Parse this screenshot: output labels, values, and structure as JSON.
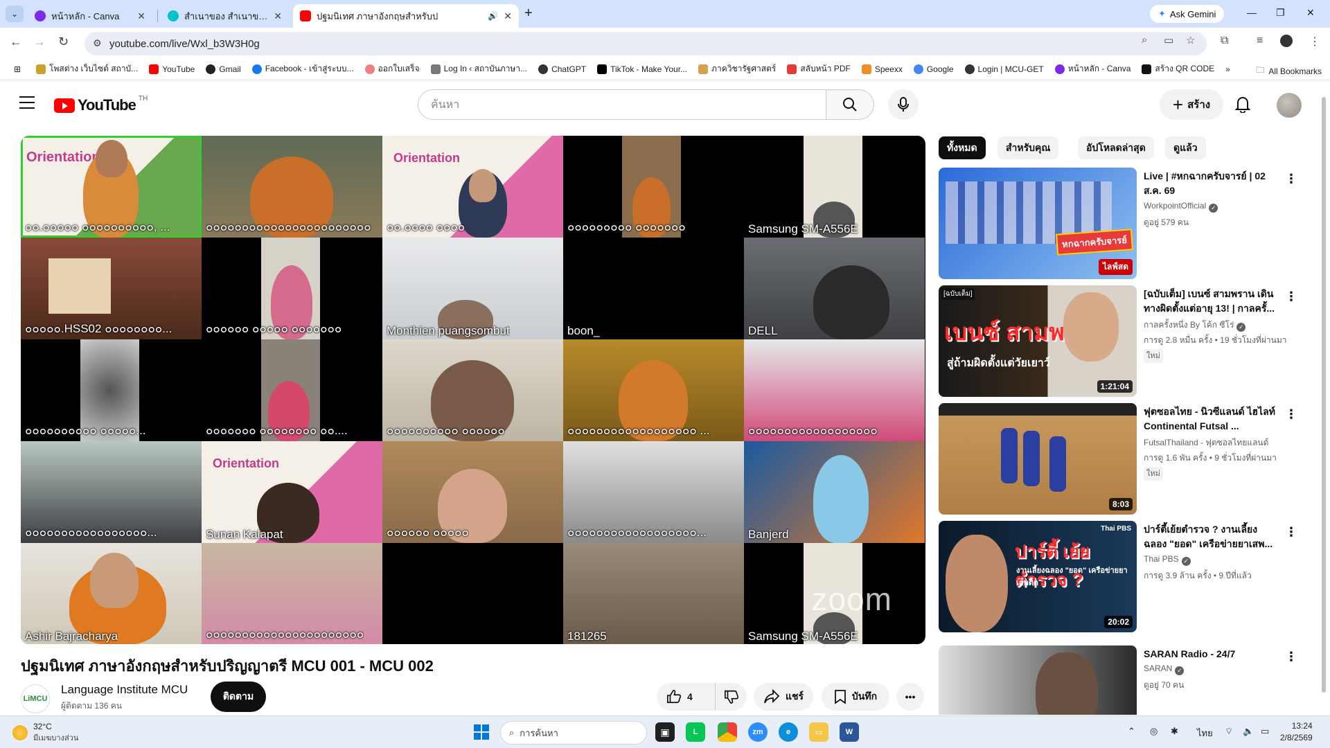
{
  "browser": {
    "tabs": [
      {
        "title": "หน้าหลัก - Canva",
        "active": false
      },
      {
        "title": "สำเนาของ สำเนาของ จดหมายข่าว -",
        "active": false
      },
      {
        "title": "ปฐมนิเทศ ภาษาอังกฤษสำหรับป",
        "active": true
      }
    ],
    "ask_gemini": "Ask Gemini",
    "url": "youtube.com/live/Wxl_b3W3H0g",
    "bookmarks": [
      "โพสต่าง เว็บไซต์ สถาบั...",
      "YouTube",
      "Gmail",
      "Facebook - เข้าสู่ระบบ...",
      "ออกใบเสร็จ",
      "Log In ‹ สถาบันภาษา...",
      "ChatGPT",
      "TikTok - Make Your...",
      "ภาควิชารัฐศาสตร์",
      "สลับหน้า PDF",
      "Speexx",
      "Google",
      "Login | MCU-GET",
      "หน้าหลัก - Canva",
      "สร้าง QR CODE"
    ],
    "all_bookmarks": "All Bookmarks"
  },
  "youtube": {
    "logo_text": "YouTube",
    "country_code": "TH",
    "search_placeholder": "ค้นหา",
    "create_label": "สร้าง"
  },
  "video": {
    "title": "ปฐมนิเทศ ภาษาอังกฤษสำหรับปริญญาตรี MCU 001 - MCU 002",
    "participants": [
      "๐๐.๐๐๐๐๐ ๐๐๐๐๐๐๐๐๐๐, ...",
      "๐๐๐๐๐๐๐๐๐๐๐๐๐๐๐๐๐๐๐๐๐๐๐",
      "๐๐.๐๐๐๐ ๐๐๐๐",
      "๐๐๐๐๐๐๐๐๐ ๐๐๐๐๐๐๐",
      "Samsung SM-A556E",
      "๐๐๐๐๐.HSS02 ๐๐๐๐๐๐๐๐...",
      "๐๐๐๐๐๐ ๐๐๐๐๐ ๐๐๐๐๐๐๐",
      "Monthien puangsombut",
      "boon_",
      "DELL",
      "๐๐๐๐๐๐๐๐๐๐ ๐๐๐๐๐...",
      "๐๐๐๐๐๐๐ ๐๐๐๐๐๐๐๐  ๐๐....",
      "๐๐๐๐๐๐๐๐๐๐ ๐๐๐๐๐๐",
      "๐๐๐๐๐๐๐๐๐๐๐๐๐๐๐๐๐๐ ...",
      "๐๐๐๐๐๐๐๐๐๐๐๐๐๐๐๐๐๐",
      "๐๐๐๐๐๐๐๐๐๐๐๐๐๐๐๐๐...",
      "Sunan Kalapat",
      "๐๐๐๐๐๐ ๐๐๐๐๐",
      "๐๐๐๐๐๐๐๐๐๐๐๐๐๐๐๐๐๐...",
      "Banjerd",
      "Ashir Bajracharya",
      "๐๐๐๐๐๐๐๐๐๐๐๐๐๐๐๐๐๐๐๐๐๐",
      "",
      "181265",
      "Samsung SM-A556E"
    ],
    "zoom_watermark": "zoom",
    "channel": {
      "name": "Language Institute MCU",
      "subscribers": "ผู้ติดตาม 136 คน",
      "avatar_text": "LiMCU",
      "subscribe_label": "ติดตาม"
    },
    "like_count": "4",
    "share_label": "แชร์",
    "save_label": "บันทึก"
  },
  "chips": [
    "ทั้งหมด",
    "สำหรับคุณ",
    "อัปโหลดล่าสุด",
    "ดูแล้ว"
  ],
  "recommendations": [
    {
      "title": "Live | #หกฉากครับจารย์ | 02 ส.ค. 69",
      "channel": "WorkpointOfficial",
      "meta": "ดูอยู่ 579 คน",
      "badge": "",
      "overlay": "ไลฟ์สด",
      "verified": true
    },
    {
      "title": "[ฉบับเต็ม] เบนซ์ สามพราน เดินทางผิดตั้งแต่อายุ 13! | กาลครั้...",
      "channel": "กาลครั้งหนึ่ง By โค้ก ซีโร่",
      "meta": "การดู 2.8 หมื่น ครั้ง • 19 ชั่วโมงที่ผ่านมา",
      "badge": "ใหม่",
      "overlay": "1:21:04",
      "verified": true
    },
    {
      "title": "ฟุตซอลไทย - นิวซีแลนด์ ไฮไลท์ Continental Futsal ...",
      "channel": "FutsalThailand - ฟุตซอลไทยแลนด์",
      "meta": "การดู 1.6 พัน ครั้ง • 9 ชั่วโมงที่ผ่านมา",
      "badge": "ใหม่",
      "overlay": "8:03",
      "verified": false
    },
    {
      "title": "ปาร์ตี้เย้ยตำรวจ ? งานเลี้ยงฉลอง \"ยอด\" เครือข่ายยาเสพ...",
      "channel": "Thai PBS",
      "meta": "การดู 3.9 ล้าน ครั้ง • 9 ปีที่แล้ว",
      "badge": "",
      "overlay": "20:02",
      "verified": true
    },
    {
      "title": "SARAN Radio - 24/7",
      "channel": "SARAN",
      "meta": "ดูอยู่ 70 คน",
      "badge": "",
      "overlay": "",
      "verified": true
    }
  ],
  "thumb_text": {
    "r1": "หกฉากครับจารย์",
    "r2": "เบนซ์ สามพราน",
    "r2b": "สู่ถ้ามผิดตั้งแต่วัยเยาว์",
    "r2c": "[ฉบับเต็ม]",
    "r4": "ปาร์ตี้ เย้ยตำรวจ ?",
    "r4b": "งานเลี้ยงฉลอง \"ยอด\" เครือข่ายยาเสพติด",
    "r4c": "Thai PBS"
  },
  "taskbar": {
    "temperature": "32°C",
    "weather": "มีเมฆบางส่วน",
    "search_placeholder": "การค้นหา",
    "language": "ไทย",
    "time": "13:24",
    "date": "2/8/2569"
  }
}
